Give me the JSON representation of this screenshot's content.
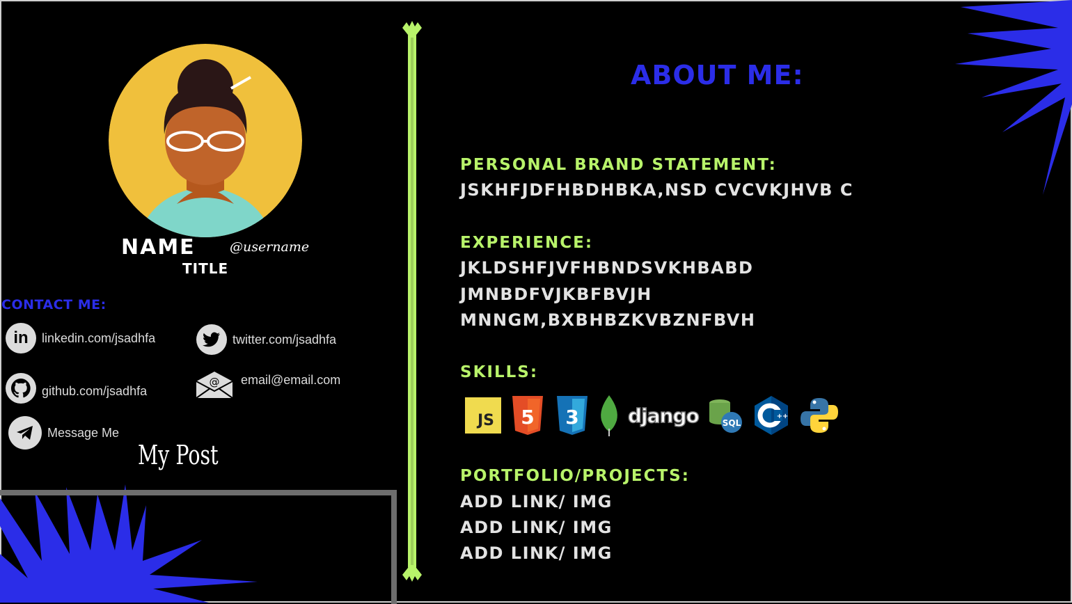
{
  "profile": {
    "name": "NAME",
    "username": "@username",
    "title": "TITLE"
  },
  "contact": {
    "heading": "CONTACT ME:",
    "linkedin": "linkedin.com/jsadhfa",
    "twitter": "twitter.com/jsadhfa",
    "github": "github.com/jsadhfa",
    "email": "email@email.com",
    "message": "Message Me"
  },
  "posts": {
    "heading": "My Post"
  },
  "about": {
    "heading": "ABOUT ME:",
    "brand_heading": "PERSONAL BRAND STATEMENT:",
    "brand_text": "JSKHFJDFHBDHBKA,NSD CVCVKJHVB C",
    "experience_heading": "EXPERIENCE:",
    "experience_lines": [
      "JKLDSHFJVFHBNDSVKHBABD",
      "JMNBDFVJKBFBVJH",
      "MNNGM,BXBHBZKVBZNFBVH"
    ],
    "skills_heading": "SKILLS:",
    "skills": [
      "JS",
      "HTML5",
      "CSS3",
      "MongoDB",
      "django",
      "SQL",
      "C++",
      "Python"
    ],
    "portfolio_heading": "PORTFOLIO/PROJECTS:",
    "portfolio_items": [
      "ADD LINK/ IMG",
      "ADD LINK/ IMG",
      "ADD LINK/ IMG"
    ]
  },
  "colors": {
    "accent_green": "#b8f36a",
    "accent_blue": "#2b2de8",
    "avatar_bg": "#f0c03c"
  },
  "icons": [
    "linkedin-icon",
    "twitter-icon",
    "github-icon",
    "email-icon",
    "telegram-icon",
    "starburst-decoration"
  ]
}
